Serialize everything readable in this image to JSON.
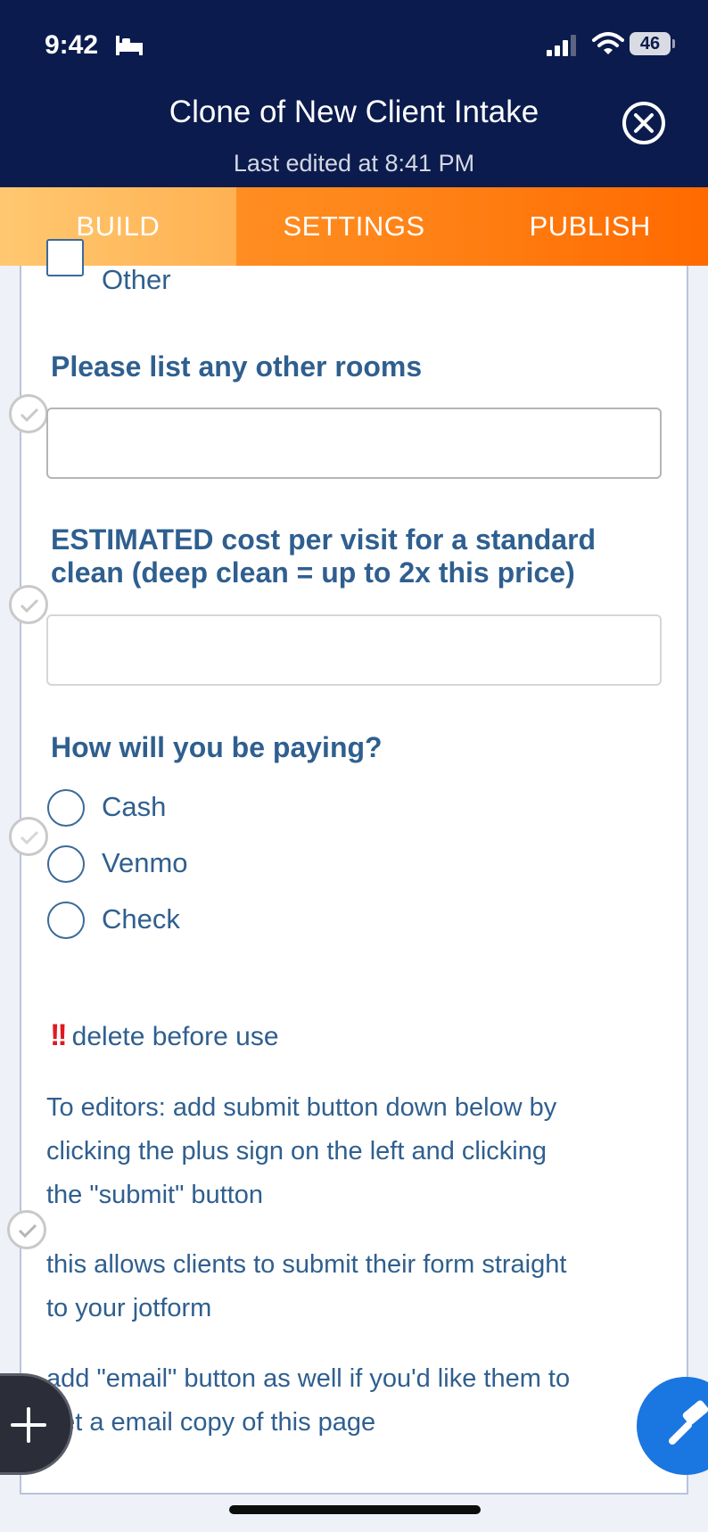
{
  "status_bar": {
    "time": "9:42",
    "battery": "46"
  },
  "header": {
    "title": "Clone of New Client Intake",
    "subtitle": "Last edited at 8:41 PM"
  },
  "tabs": [
    {
      "label": "BUILD",
      "active": true
    },
    {
      "label": "SETTINGS",
      "active": false
    },
    {
      "label": "PUBLISH",
      "active": false
    }
  ],
  "form": {
    "checkbox_other": "Other",
    "q_rooms": "Please list any other rooms",
    "q_cost_line1": "ESTIMATED cost per visit for a standard",
    "q_cost_line2": "clean (deep clean = up to 2x this price)",
    "q_pay": "How will you be paying?",
    "pay_options": [
      "Cash",
      "Venmo",
      "Check"
    ],
    "warn_marks": "!!",
    "warn_text": "delete before use",
    "p1_lines": [
      "To editors: add submit button down below by",
      "clicking the plus sign on the left and clicking",
      "the \"submit\" button"
    ],
    "p2_lines": [
      "this allows clients to submit their form straight",
      "to your jotform"
    ],
    "p3_lines": [
      "add \"email\" button as well if you'd like them to",
      "get a email copy of this page"
    ]
  },
  "colors": {
    "header_bg": "#0b1b4d",
    "accent_orange": "#ff8519",
    "text_blue": "#2f5f8f",
    "fab_blue": "#1a76e0"
  }
}
